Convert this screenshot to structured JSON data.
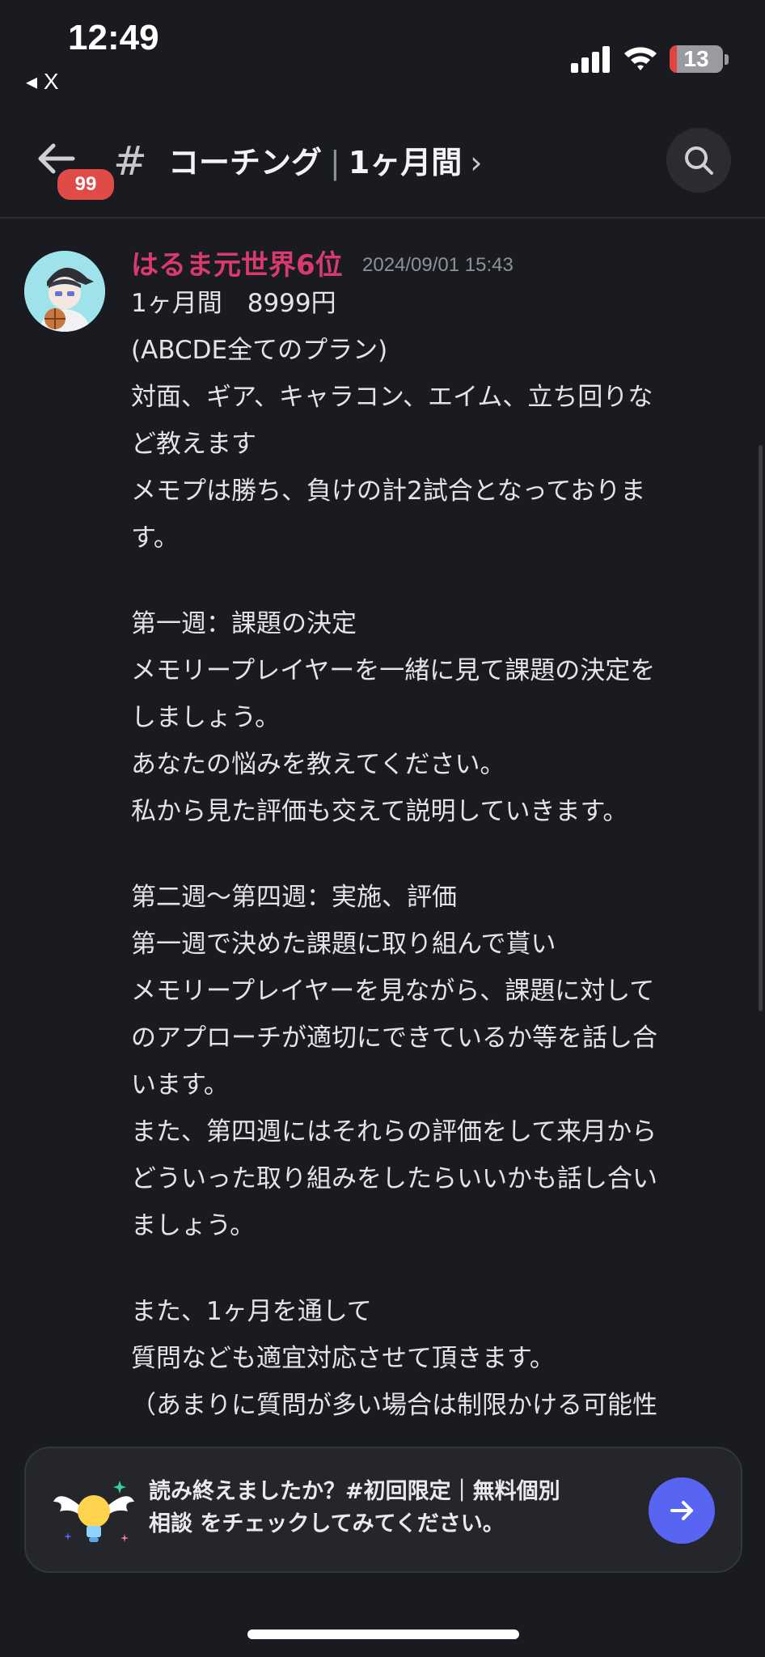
{
  "status_bar": {
    "time": "12:49",
    "back_app": "◂ X",
    "battery_level": "13",
    "battery_fraction": 0.13
  },
  "header": {
    "badge_count": "99",
    "channel_prefix": "#",
    "channel_name": "コーチング",
    "channel_sub": "1ヶ月間",
    "chevron": "›",
    "separator": "|"
  },
  "message": {
    "author": "はるま元世界6位",
    "timestamp": "2024/09/01 15:43",
    "lines": [
      "1ヶ月間　8999円",
      "(ABCDE全てのプラン)",
      "対面、ギア、キャラコン、エイム、立ち回りな",
      "ど教えます",
      "メモプは勝ち、負けの計2試合となっておりま",
      "す。",
      "",
      "第一週：課題の決定",
      "メモリープレイヤーを一緒に見て課題の決定を",
      "しましょう。",
      "あなたの悩みを教えてください。",
      "私から見た評価も交えて説明していきます。",
      "",
      "第二週〜第四週：実施、評価",
      "第一週で決めた課題に取り組んで貰い",
      "メモリープレイヤーを見ながら、課題に対して",
      "のアプローチが適切にできているか等を話し合",
      "います。",
      "また、第四週にはそれらの評価をして来月から",
      "どういった取り組みをしたらいいかも話し合い",
      "ましょう。",
      "",
      "また、1ヶ月を通して",
      "質問なども適宜対応させて頂きます。",
      "（あまりに質問が多い場合は制限かける可能性"
    ]
  },
  "prompt": {
    "line1": "読み終えましたか？#初回限定｜無料個別",
    "line2": "相談 をチェックしてみてください。"
  },
  "colors": {
    "background": "#1a1b20",
    "author": "#d83a6e",
    "accent": "#5865f2",
    "badge": "#e04b48"
  },
  "icons": [
    "back-arrow-icon",
    "hash-icon",
    "search-icon",
    "lightbulb-wings-icon",
    "arrow-right-icon",
    "signal-icon",
    "wifi-icon",
    "battery-icon"
  ]
}
